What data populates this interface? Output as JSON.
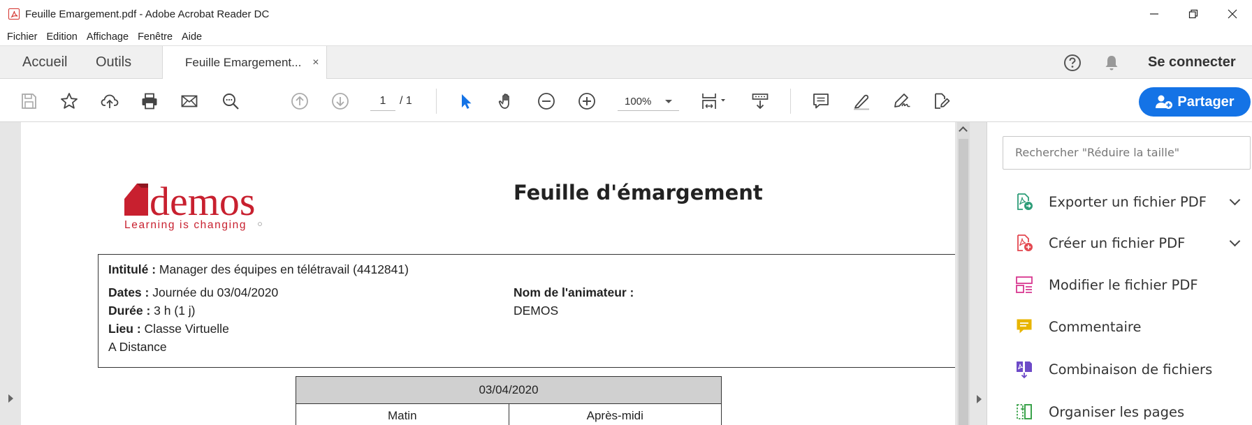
{
  "window": {
    "title": "Feuille Emargement.pdf - Adobe Acrobat Reader DC"
  },
  "menu": [
    "Fichier",
    "Edition",
    "Affichage",
    "Fenêtre",
    "Aide"
  ],
  "tabs": {
    "home": "Accueil",
    "tools": "Outils",
    "document": "Feuille Emargement...",
    "close_glyph": "×"
  },
  "header": {
    "signin": "Se connecter"
  },
  "toolbar": {
    "page_current": "1",
    "page_total": "/ 1",
    "zoom": "100%",
    "share_label": "Partager"
  },
  "document": {
    "title": "Feuille d'émargement",
    "logo_text": "demos",
    "logo_tagline": "Learning is changing",
    "intitule_label": "Intitulé :",
    "intitule_value": "Manager des équipes en télétravail (4412841)",
    "dates_label": "Dates :",
    "dates_value": "Journée du 03/04/2020",
    "duree_label": "Durée :",
    "duree_value": "3 h (1 j)",
    "lieu_label": "Lieu :",
    "lieu_value": "Classe Virtuelle",
    "lieu_value2": "A Distance",
    "animateur_label": "Nom de l'animateur :",
    "animateur_value": "DEMOS",
    "table": {
      "date": "03/04/2020",
      "col_morning": "Matin",
      "col_afternoon": "Après-midi"
    }
  },
  "right_panel": {
    "search_placeholder": "Rechercher \"Réduire la taille\"",
    "tools": [
      {
        "label": "Exporter un fichier PDF",
        "icon": "export-pdf-icon",
        "color": "#2d9d78"
      },
      {
        "label": "Créer un fichier PDF",
        "icon": "create-pdf-icon",
        "color": "#e34850"
      },
      {
        "label": "Modifier le fichier PDF",
        "icon": "edit-pdf-icon",
        "color": "#d83790"
      },
      {
        "label": "Commentaire",
        "icon": "comment-icon",
        "color": "#e8b500"
      },
      {
        "label": "Combinaison de fichiers",
        "icon": "combine-files-icon",
        "color": "#6d4ac8"
      },
      {
        "label": "Organiser les pages",
        "icon": "organize-pages-icon",
        "color": "#3ba34b"
      }
    ]
  },
  "colors": {
    "accent": "#1473e6",
    "logo_red": "#c8202f"
  }
}
